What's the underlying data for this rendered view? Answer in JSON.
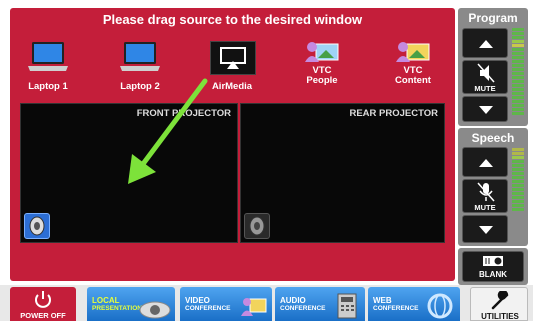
{
  "main": {
    "title": "Please drag source to the desired window",
    "sources": [
      {
        "label": "Laptop 1",
        "icon": "laptop-icon"
      },
      {
        "label": "Laptop 2",
        "icon": "laptop-icon"
      },
      {
        "label": "AirMedia",
        "icon": "airmedia-icon"
      },
      {
        "label": "VTC\nPeople",
        "icon": "people-icon"
      },
      {
        "label": "VTC\nContent",
        "icon": "content-icon"
      }
    ],
    "windows": [
      {
        "label": "FRONT PROJECTOR",
        "audio": "active"
      },
      {
        "label": "REAR PROJECTOR",
        "audio": "inactive"
      }
    ]
  },
  "program": {
    "title": "Program",
    "mute_label": "MUTE"
  },
  "speech": {
    "title": "Speech",
    "mute_label": "MUTE"
  },
  "blank_label": "BLANK",
  "bottom": {
    "power_label": "POWER OFF",
    "local_1": "LOCAL",
    "local_2": "PRESENTATION",
    "video_1": "VIDEO",
    "video_2": "CONFERENCE",
    "audio_1": "AUDIO",
    "audio_2": "CONFERENCE",
    "web_1": "WEB",
    "web_2": "CONFERENCE",
    "utilities_label": "UTILITIES"
  },
  "colors": {
    "panel_red": "#c41e3a",
    "accent_blue": "#2c6ed5",
    "arrow_green": "#7de23a"
  }
}
